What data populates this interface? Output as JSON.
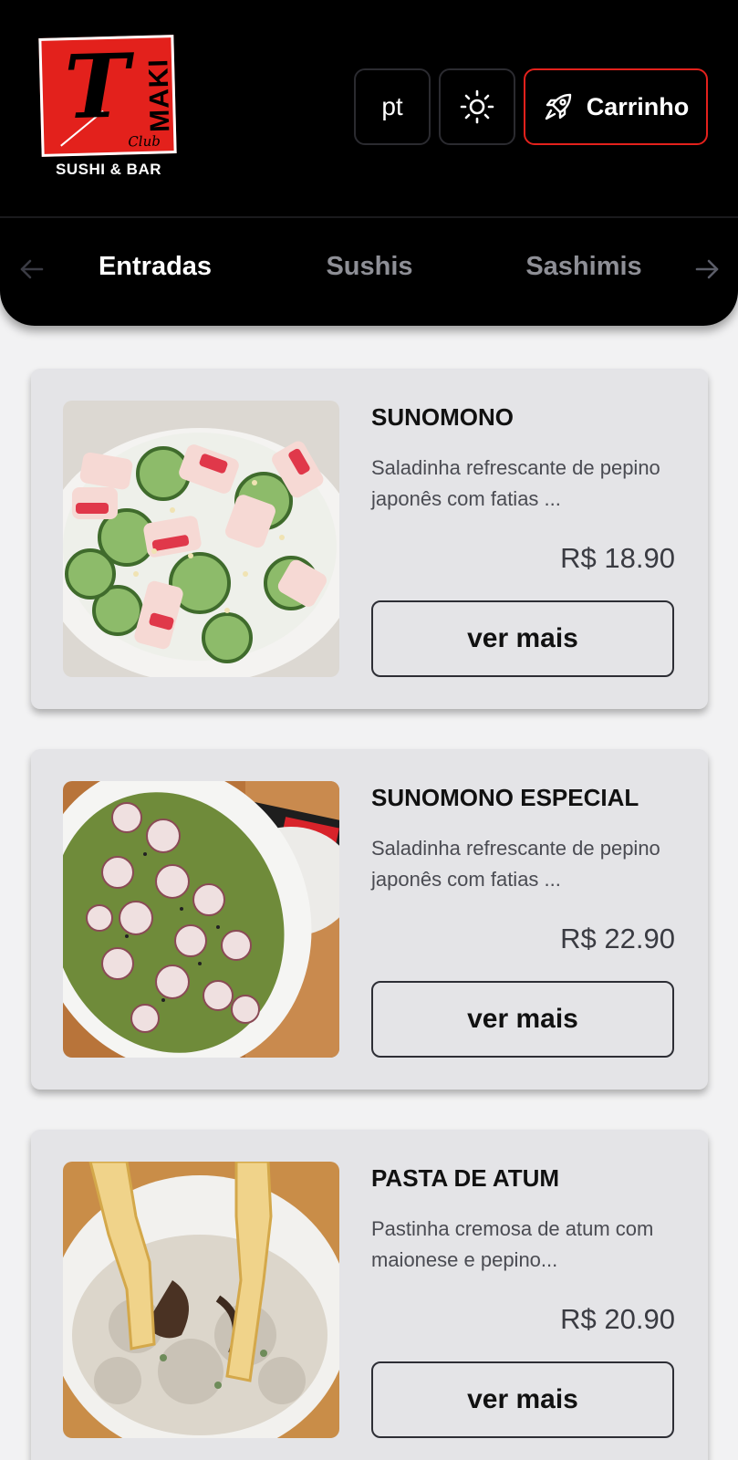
{
  "logo": {
    "letter": "T",
    "word": "MAKI",
    "script": "Club",
    "subtitle": "SUSHI & BAR"
  },
  "header": {
    "language_label": "pt",
    "cart_label": "Carrinho"
  },
  "colors": {
    "accent": "#e3211c",
    "header_bg": "#000000",
    "card_bg": "#e4e4e7"
  },
  "tabs": [
    {
      "label": "Entradas",
      "active": true
    },
    {
      "label": "Sushis",
      "active": false
    },
    {
      "label": "Sashimis",
      "active": false
    }
  ],
  "products": [
    {
      "title": "SUNOMONO",
      "description": "Saladinha refrescante de pepino japonês com fatias ...",
      "price": "R$ 18.90",
      "button_label": "ver mais"
    },
    {
      "title": "SUNOMONO ESPECIAL",
      "description": "Saladinha refrescante de pepino japonês com fatias ...",
      "price": "R$ 22.90",
      "button_label": "ver mais"
    },
    {
      "title": "PASTA DE ATUM",
      "description": "Pastinha cremosa de atum com maionese e pepino...",
      "price": "R$ 20.90",
      "button_label": "ver mais"
    }
  ]
}
